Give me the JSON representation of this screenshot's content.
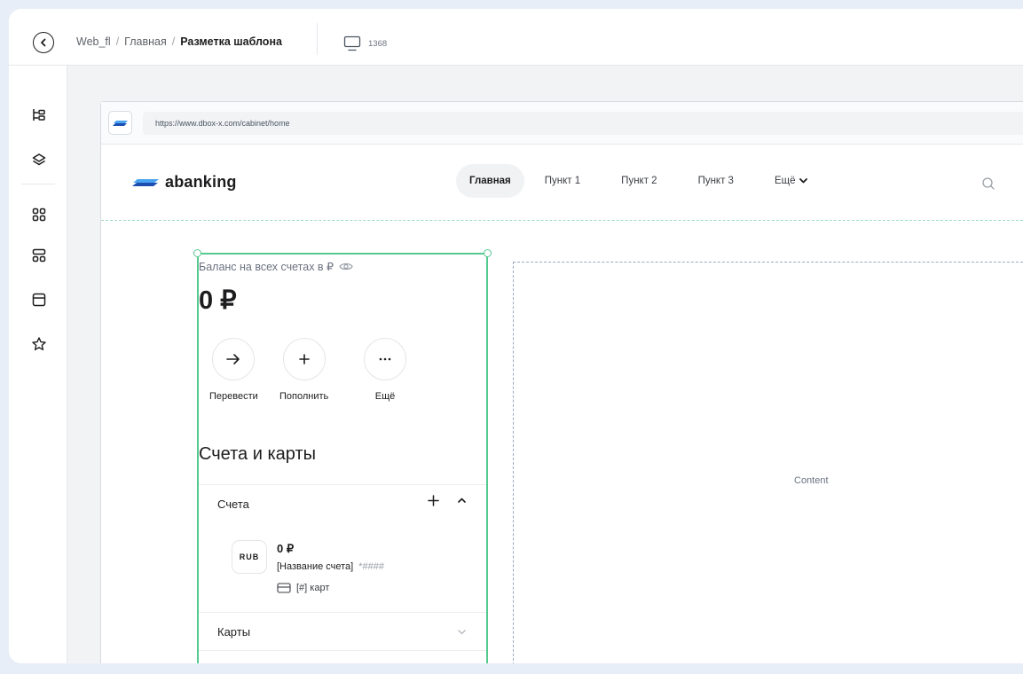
{
  "toolbar": {
    "breadcrumbs": [
      "Web_fl",
      "Главная",
      "Разметка шаблона"
    ],
    "viewport_width": "1368"
  },
  "sidebar": {
    "tools": [
      {
        "name": "tree-icon"
      },
      {
        "name": "layers-icon"
      },
      {
        "name": "grid-icon"
      },
      {
        "name": "components-icon"
      },
      {
        "name": "layout-icon"
      },
      {
        "name": "star-icon"
      }
    ]
  },
  "browser": {
    "url": "https://www.dbox-x.com/cabinet/home"
  },
  "site": {
    "logo_text": "abanking",
    "nav": [
      "Главная",
      "Пункт 1",
      "Пункт 2",
      "Пункт 3",
      "Ещё"
    ],
    "active_nav": "Главная"
  },
  "widget": {
    "balance_label": "Баланс на всех счетах в ₽",
    "balance_value": "0 ₽",
    "actions": [
      {
        "icon": "arrow-right-icon",
        "label": "Перевести"
      },
      {
        "icon": "plus-icon",
        "label": "Пополнить"
      },
      {
        "icon": "more-icon",
        "label": "Ещё"
      }
    ],
    "section_title": "Счета и карты",
    "accounts_header": "Счета",
    "account": {
      "currency": "RUB",
      "amount": "0 ₽",
      "name": "[Название счета]",
      "mask": "*####",
      "cards": "[#] карт"
    },
    "cards_header": "Карты"
  },
  "content": {
    "label": "Content"
  },
  "colors": {
    "selection": "#56c98f",
    "brand": "#2f6fd6"
  }
}
